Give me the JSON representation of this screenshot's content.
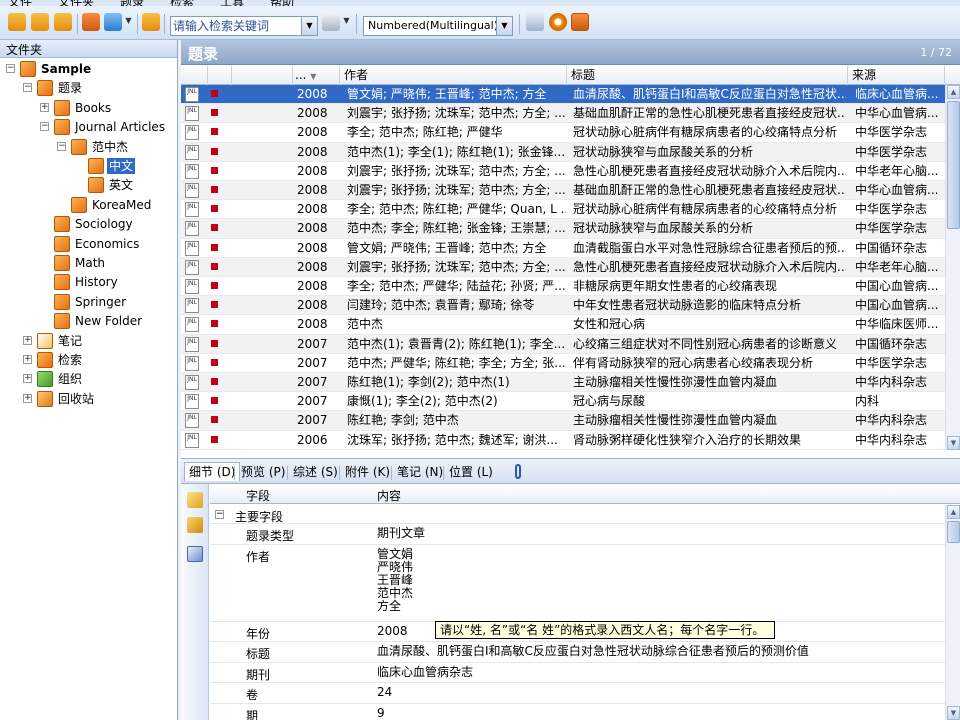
{
  "menu": [
    "文件",
    "文件夹",
    "题录",
    "检索",
    "工具",
    "帮助"
  ],
  "toolbar": {
    "search_placeholder": "请输入检索关键词",
    "style_value": "Numbered(Multilingual)"
  },
  "tree": {
    "header": "文件夹",
    "items": [
      {
        "label": "Sample",
        "level": 0,
        "exp": "−",
        "bold": true
      },
      {
        "label": "题录",
        "level": 1,
        "exp": "−"
      },
      {
        "label": "Books",
        "level": 2,
        "exp": "+"
      },
      {
        "label": "Journal Articles",
        "level": 2,
        "exp": "−"
      },
      {
        "label": "范中杰",
        "level": 3,
        "exp": "−"
      },
      {
        "label": "中文",
        "level": 4,
        "exp": "",
        "selected": true
      },
      {
        "label": "英文",
        "level": 4,
        "exp": ""
      },
      {
        "label": "KoreaMed",
        "level": 3,
        "exp": ""
      },
      {
        "label": "Sociology",
        "level": 2,
        "exp": ""
      },
      {
        "label": "Economics",
        "level": 2,
        "exp": ""
      },
      {
        "label": "Math",
        "level": 2,
        "exp": ""
      },
      {
        "label": "History",
        "level": 2,
        "exp": ""
      },
      {
        "label": "Springer",
        "level": 2,
        "exp": ""
      },
      {
        "label": "New Folder",
        "level": 2,
        "exp": ""
      },
      {
        "label": "笔记",
        "level": 1,
        "exp": "+",
        "icon": "note"
      },
      {
        "label": "检索",
        "level": 1,
        "exp": "+"
      },
      {
        "label": "组织",
        "level": 1,
        "exp": "+",
        "icon": "grp"
      },
      {
        "label": "回收站",
        "level": 1,
        "exp": "+",
        "icon": "trash"
      }
    ]
  },
  "list": {
    "title": "题录",
    "count": "1 / 72",
    "columns": [
      "...",
      "作者",
      "标题",
      "来源"
    ],
    "jnl": "JNL",
    "rows": [
      {
        "year": "2008",
        "author": "管文娟; 严晓伟; 王晋峰; 范中杰; 方全",
        "title": "血清尿酸、肌钙蛋白I和高敏C反应蛋白对急性冠状...",
        "source": "临床心血管病..."
      },
      {
        "year": "2008",
        "author": "刘震宇; 张抒扬; 沈珠军; 范中杰; 方全; ...",
        "title": "基础血肌酐正常的急性心肌梗死患者直接经皮冠状...",
        "source": "中华心血管病..."
      },
      {
        "year": "2008",
        "author": "李全; 范中杰; 陈红艳; 严健华",
        "title": "冠状动脉心脏病伴有糖尿病患者的心绞痛特点分析",
        "source": "中华医学杂志"
      },
      {
        "year": "2008",
        "author": "范中杰(1); 李全(1); 陈红艳(1); 张金锋...",
        "title": "冠状动脉狭窄与血尿酸关系的分析",
        "source": "中华医学杂志"
      },
      {
        "year": "2008",
        "author": "刘震宇; 张抒扬; 沈珠军; 范中杰; 方全; ...",
        "title": "急性心肌梗死患者直接经皮冠状动脉介入术后院内...",
        "source": "中华老年心脑..."
      },
      {
        "year": "2008",
        "author": "刘震宇; 张抒扬; 沈珠军; 范中杰; 方全; ...",
        "title": "基础血肌酐正常的急性心肌梗死患者直接经皮冠状...",
        "source": "中华心血管病..."
      },
      {
        "year": "2008",
        "author": "李全; 范中杰; 陈红艳; 严健华; Quan, L ...",
        "title": "冠状动脉心脏病伴有糖尿病患者的心绞痛特点分析",
        "source": "中华医学杂志"
      },
      {
        "year": "2008",
        "author": "范中杰; 李全; 陈红艳; 张金锋; 王崇慧; ...",
        "title": "冠状动脉狭窄与血尿酸关系的分析",
        "source": "中华医学杂志"
      },
      {
        "year": "2008",
        "author": "管文娟; 严晓伟; 王晋峰; 范中杰; 方全",
        "title": "血清截脂蛋白水平对急性冠脉综合征患者预后的预...",
        "source": "中国循环杂志"
      },
      {
        "year": "2008",
        "author": "刘震宇; 张抒扬; 沈珠军; 范中杰; 方全; ...",
        "title": "急性心肌梗死患者直接经皮冠状动脉介入术后院内...",
        "source": "中华老年心脑..."
      },
      {
        "year": "2008",
        "author": "李全; 范中杰; 严健华; 陆益花; 孙贤; 严...",
        "title": "非糖尿病更年期女性患者的心绞痛表现",
        "source": "中国心血管病..."
      },
      {
        "year": "2008",
        "author": "闫建玲; 范中杰; 袁晋青; 鄢琦; 徐苓",
        "title": "中年女性患者冠状动脉造影的临床特点分析",
        "source": "中国心血管病..."
      },
      {
        "year": "2008",
        "author": "范中杰",
        "title": "女性和冠心病",
        "source": "中华临床医师..."
      },
      {
        "year": "2007",
        "author": "范中杰(1); 袁晋青(2); 陈红艳(1); 李全...",
        "title": "心绞痛三组症状对不同性别冠心病患者的诊断意义",
        "source": "中国循环杂志"
      },
      {
        "year": "2007",
        "author": "范中杰; 严健华; 陈红艳; 李全; 方全; 张...",
        "title": "伴有肾动脉狭窄的冠心病患者心绞痛表现分析",
        "source": "中华医学杂志"
      },
      {
        "year": "2007",
        "author": "陈红艳(1); 李剑(2); 范中杰(1)",
        "title": "主动脉瘤相关性慢性弥漫性血管内凝血",
        "source": "中华内科杂志"
      },
      {
        "year": "2007",
        "author": "康慨(1); 李全(2); 范中杰(2)",
        "title": "冠心病与尿酸",
        "source": "内科"
      },
      {
        "year": "2007",
        "author": "陈红艳; 李剑; 范中杰",
        "title": "主动脉瘤相关性慢性弥漫性血管内凝血",
        "source": "中华内科杂志"
      },
      {
        "year": "2006",
        "author": "沈珠军; 张抒扬; 范中杰; 魏述军; 谢洪...",
        "title": "肾动脉粥样硬化性狭窄介入治疗的长期效果",
        "source": "中华内科杂志"
      }
    ]
  },
  "tabs": [
    "细节 (D)",
    "预览 (P)",
    "综述 (S)",
    "附件 (K)",
    "笔记 (N)",
    "位置 (L)"
  ],
  "detail": {
    "col_field": "字段",
    "col_content": "内容",
    "group": "主要字段",
    "fields": [
      {
        "name": "题录类型",
        "value": "期刊文章"
      },
      {
        "name": "作者",
        "value": "管文娟\n严晓伟\n王晋峰\n范中杰\n方全"
      },
      {
        "name": "年份",
        "value": "2008"
      },
      {
        "name": "标题",
        "value": "血清尿酸、肌钙蛋白I和高敏C反应蛋白对急性冠状动脉综合征患者预后的预测价值"
      },
      {
        "name": "期刊",
        "value": "临床心血管病杂志"
      },
      {
        "name": "卷",
        "value": "24"
      },
      {
        "name": "期",
        "value": "9"
      }
    ],
    "tooltip": "请以“姓, 名”或“名 姓”的格式录入西文人名；每个名字一行。"
  }
}
